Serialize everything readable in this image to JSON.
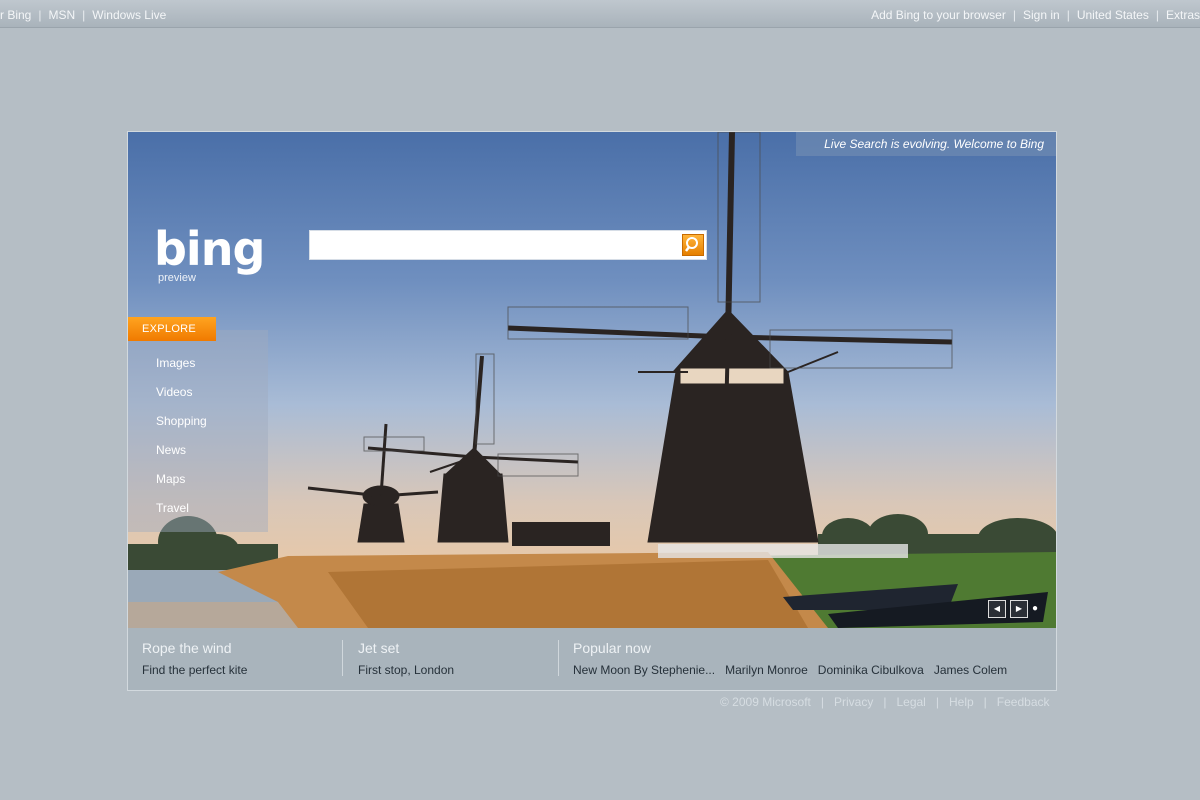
{
  "topbar": {
    "left": [
      "r Bing",
      "MSN",
      "Windows Live"
    ],
    "right": [
      "Add Bing to your browser",
      "Sign in",
      "United States",
      "Extras"
    ]
  },
  "hero": {
    "tagline": "Live Search is evolving. Welcome to Bing",
    "logo": "bing",
    "logo_sub": "preview",
    "search_placeholder": ""
  },
  "explore": {
    "label": "EXPLORE",
    "items": [
      "Images",
      "Videos",
      "Shopping",
      "News",
      "Maps",
      "Travel"
    ]
  },
  "panels": [
    {
      "title": "Rope the wind",
      "links": [
        "Find the perfect kite"
      ]
    },
    {
      "title": "Jet set",
      "links": [
        "First stop, London"
      ]
    },
    {
      "title": "Popular now",
      "links": [
        "New Moon By Stephenie...",
        "Marilyn Monroe",
        "Dominika Cibulkova",
        "James Colem"
      ]
    }
  ],
  "footer": [
    "© 2009 Microsoft",
    "Privacy",
    "Legal",
    "Help",
    "Feedback"
  ],
  "colors": {
    "page_bg": "#b5bec5",
    "accent": "#f07a00",
    "panel_bg": "#a9b4bc"
  }
}
